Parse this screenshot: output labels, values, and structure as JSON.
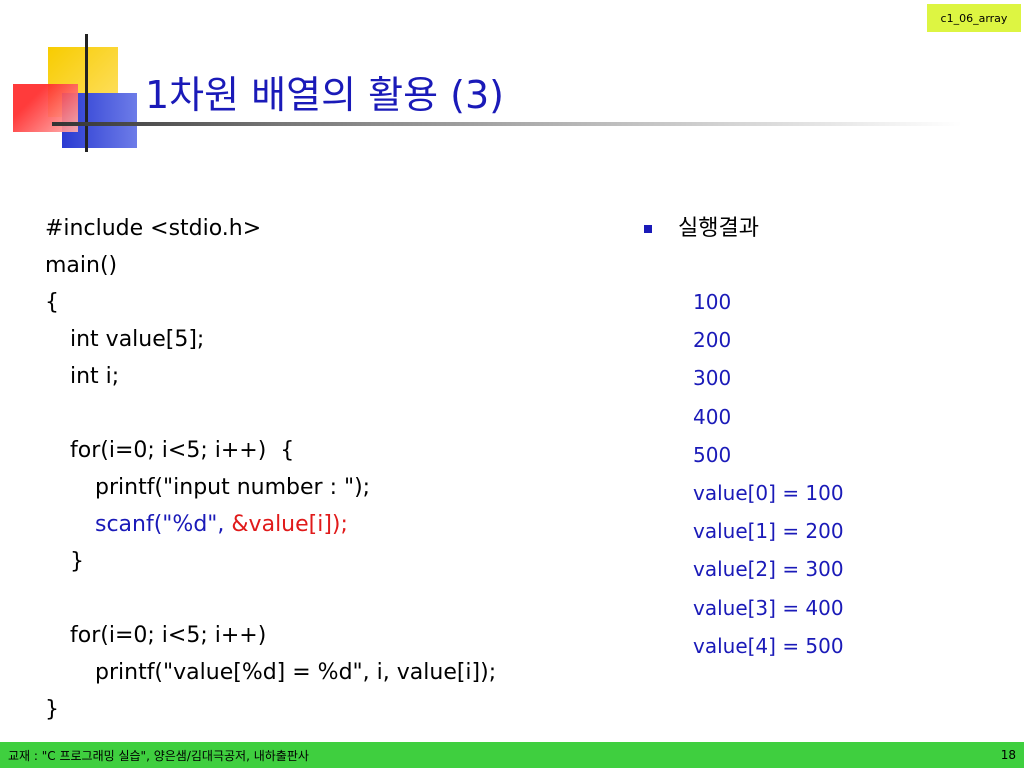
{
  "slide_tag": "c1_06_array",
  "title": "1차원 배열의 활용 (3)",
  "code": {
    "line1": "#include <stdio.h>",
    "line2": "main()",
    "line3": "{",
    "line4": "int value[5];",
    "line5": "int i;",
    "line6": "for(i=0; i<5; i++)  {",
    "line7": "printf(\"input number : \");",
    "line8_a": "scanf(\"%d\", ",
    "line8_b": "&value[i]);",
    "line9": "}",
    "line10": "for(i=0; i<5; i++)",
    "line11": "printf(\"value[%d] = %d\", i, value[i]);",
    "line12": "}"
  },
  "results": {
    "heading": "실행결과",
    "lines": [
      "100",
      "200",
      "300",
      "400",
      "500",
      "value[0] = 100",
      "value[1] = 200",
      "value[2] = 300",
      "value[3] = 400",
      "value[4] = 500"
    ]
  },
  "footer": {
    "text": "교재 : \"C 프로그래밍 실습\", 양은샘/김대극공저, 내하출판사",
    "page_number": "18"
  },
  "colors": {
    "title": "#1a1ab8",
    "highlight_blue": "#1a1ab8",
    "highlight_red": "#e01a1a",
    "footer_bg": "#3fcf3f",
    "tag_bg": "#ddf542"
  }
}
